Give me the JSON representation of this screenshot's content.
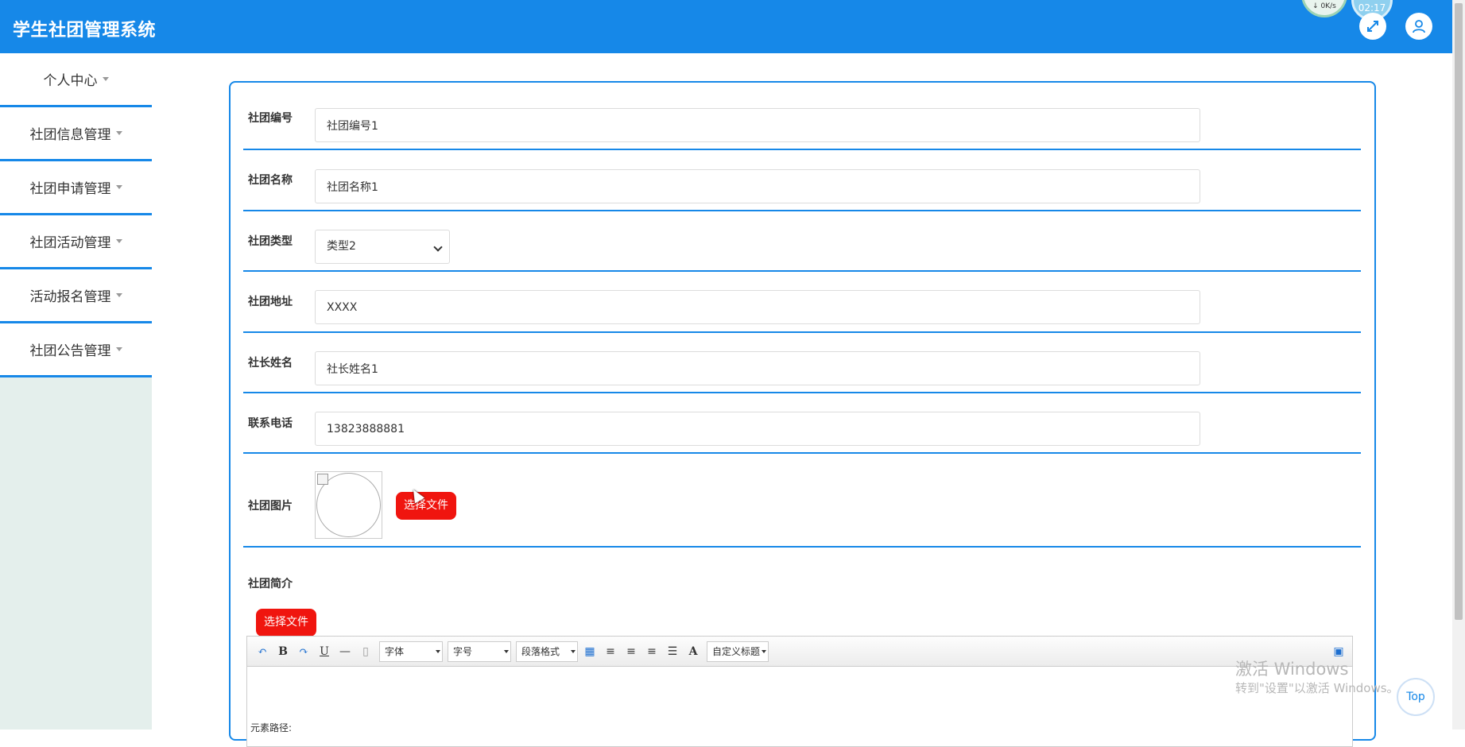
{
  "app": {
    "title": "学生社团管理系统"
  },
  "header": {
    "net_speed": "0K/s",
    "clock": "02:17",
    "expand_icon": "expand-icon",
    "user_icon": "user-icon"
  },
  "sidebar": {
    "items": [
      {
        "label": "个人中心"
      },
      {
        "label": "社团信息管理"
      },
      {
        "label": "社团申请管理"
      },
      {
        "label": "社团活动管理"
      },
      {
        "label": "活动报名管理"
      },
      {
        "label": "社团公告管理"
      }
    ]
  },
  "form": {
    "club_number": {
      "label": "社团编号",
      "value": "社团编号1"
    },
    "club_name": {
      "label": "社团名称",
      "value": "社团名称1"
    },
    "club_type": {
      "label": "社团类型",
      "value": "类型2"
    },
    "club_address": {
      "label": "社团地址",
      "value": "XXXX"
    },
    "leader_name": {
      "label": "社长姓名",
      "value": "社长姓名1"
    },
    "phone": {
      "label": "联系电话",
      "value": "13823888881"
    },
    "club_image": {
      "label": "社团图片",
      "button": "选择文件"
    },
    "club_intro": {
      "label": "社团简介",
      "button": "选择文件"
    }
  },
  "editor": {
    "font_family": "字体",
    "font_size": "字号",
    "paragraph": "段落格式",
    "custom_title": "自定义标题",
    "status_path": "元素路径:"
  },
  "watermark": {
    "line1": "激活 Windows",
    "line2": "转到\"设置\"以激活 Windows。"
  },
  "top_button": "Top",
  "colors": {
    "primary": "#1688e8",
    "danger": "#f0150f",
    "sidebar_bg": "#e4efec"
  }
}
